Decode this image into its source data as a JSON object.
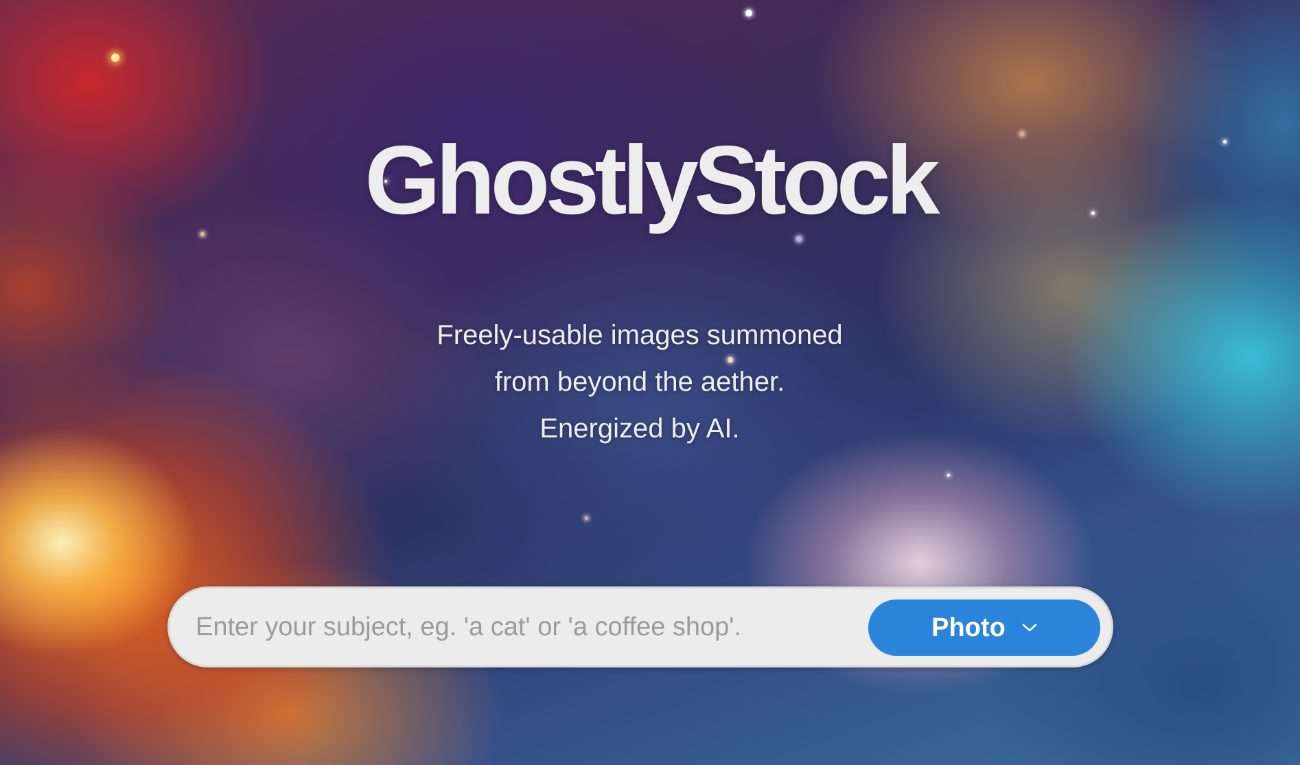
{
  "hero": {
    "title": "GhostlyStock",
    "tagline": [
      "Freely-usable images summoned",
      "from beyond the aether.",
      "Energized by AI."
    ]
  },
  "search": {
    "placeholder": "Enter your subject, eg. 'a cat' or 'a coffee shop'.",
    "value": "",
    "type_selected": "Photo",
    "type_icon": "chevron-down-icon"
  },
  "colors": {
    "accent": "#2a84da",
    "search_bg": "#ececec",
    "title_text": "#ededed"
  }
}
